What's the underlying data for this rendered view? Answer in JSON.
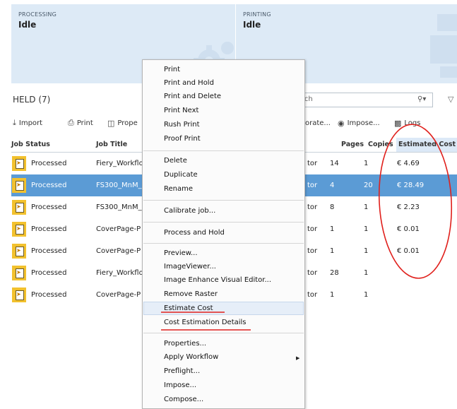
{
  "status": {
    "processing": {
      "caption": "PROCESSING",
      "value": "Idle"
    },
    "printing": {
      "caption": "PRINTING",
      "value": "Idle"
    }
  },
  "held": {
    "title": "HELD (7)"
  },
  "search": {
    "placeholder": "rch"
  },
  "toolbar": {
    "import": "Import",
    "print": "Print",
    "properties": "Prope",
    "calibrate": "orate...",
    "impose": "Impose...",
    "logs": "Logs"
  },
  "table": {
    "headers": {
      "status": "Job Status",
      "title": "Job Title",
      "pages": "Pages",
      "copies": "Copies",
      "cost": "Estimated Cost"
    },
    "rows": [
      {
        "status": "Processed",
        "title": "Fiery_Workflo",
        "extra": "tor",
        "pages": "14",
        "copies": "1",
        "cost": "€ 4.69"
      },
      {
        "status": "Processed",
        "title": "FS300_MnM_",
        "extra": "tor",
        "pages": "4",
        "copies": "20",
        "cost": "€ 28.49"
      },
      {
        "status": "Processed",
        "title": "FS300_MnM_",
        "extra": "tor",
        "pages": "8",
        "copies": "1",
        "cost": "€ 2.23"
      },
      {
        "status": "Processed",
        "title": "CoverPage-P",
        "extra": "tor",
        "pages": "1",
        "copies": "1",
        "cost": "€ 0.01"
      },
      {
        "status": "Processed",
        "title": "CoverPage-P",
        "extra": "tor",
        "pages": "1",
        "copies": "1",
        "cost": "€ 0.01"
      },
      {
        "status": "Processed",
        "title": "Fiery_Workflo",
        "extra": "tor",
        "pages": "28",
        "copies": "1",
        "cost": ""
      },
      {
        "status": "Processed",
        "title": "CoverPage-P",
        "extra": "tor",
        "pages": "1",
        "copies": "1",
        "cost": ""
      }
    ]
  },
  "menu": {
    "items": [
      "Print",
      "Print and Hold",
      "Print and Delete",
      "Print Next",
      "Rush Print",
      "Proof Print",
      "Delete",
      "Duplicate",
      "Rename",
      "Calibrate job...",
      "Process and Hold",
      "Preview...",
      "ImageViewer...",
      "Image Enhance Visual Editor...",
      "Remove Raster",
      "Estimate Cost",
      "Cost Estimation Details",
      "Properties...",
      "Apply Workflow",
      "Preflight...",
      "Impose...",
      "Compose..."
    ]
  },
  "colors": {
    "selected_row": "#5b9bd5",
    "annotation": "#e0201c",
    "job_icon": "#f2c12e",
    "panel": "#ddeaf6"
  }
}
